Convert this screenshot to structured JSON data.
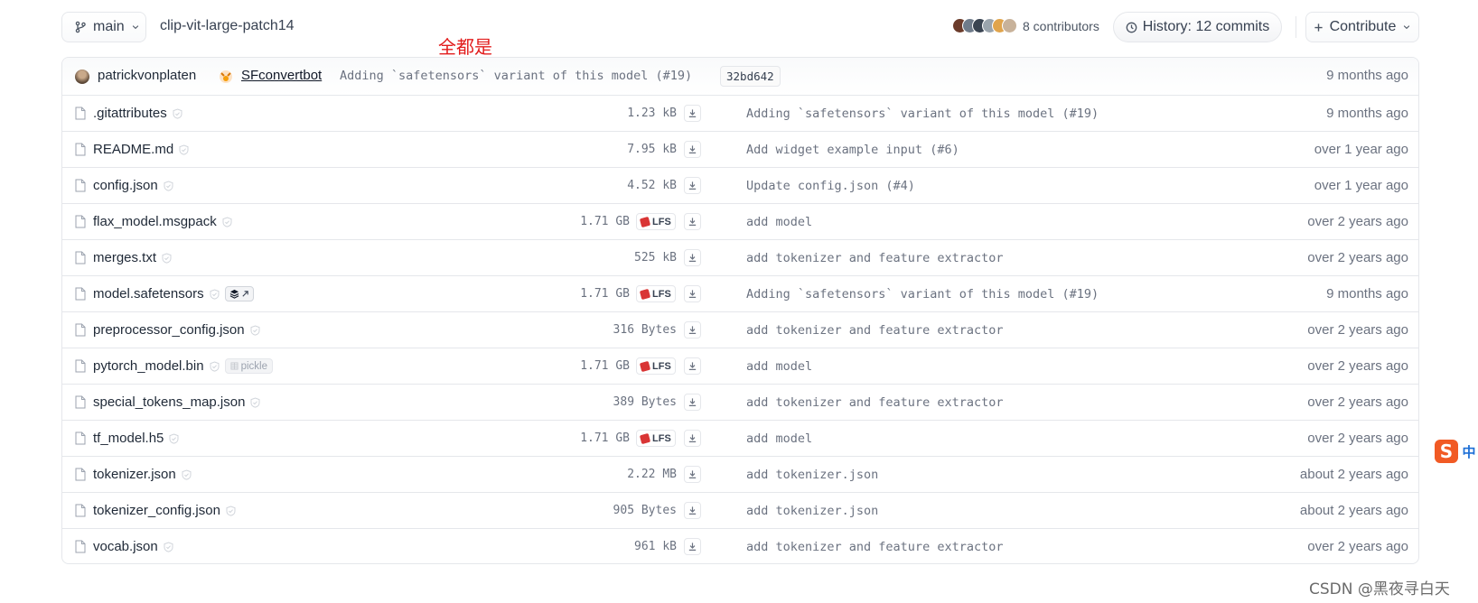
{
  "header": {
    "branch": "main",
    "repo_path": "clip-vit-large-patch14",
    "contributors_label": "8 contributors",
    "history_label": "History: 12 commits",
    "contribute_label": "Contribute"
  },
  "annotation": "全都是",
  "last_commit": {
    "author": "patrickvonplaten",
    "coauthor": "SFconvertbot",
    "message": "Adding `safetensors` variant of this model (#19)",
    "sha": "32bd642",
    "time": "9 months ago"
  },
  "files": [
    {
      "name": ".gitattributes",
      "size": "1.23 kB",
      "lfs": false,
      "message": "Adding `safetensors` variant of this model (#19)",
      "time": "9 months ago"
    },
    {
      "name": "README.md",
      "size": "7.95 kB",
      "lfs": false,
      "message": "Add widget example input (#6)",
      "time": "over 1 year ago"
    },
    {
      "name": "config.json",
      "size": "4.52 kB",
      "lfs": false,
      "message": "Update config.json (#4)",
      "time": "over 1 year ago"
    },
    {
      "name": "flax_model.msgpack",
      "size": "1.71 GB",
      "lfs": true,
      "message": "add model",
      "time": "over 2 years ago"
    },
    {
      "name": "merges.txt",
      "size": "525 kB",
      "lfs": false,
      "message": "add tokenizer and feature extractor",
      "time": "over 2 years ago"
    },
    {
      "name": "model.safetensors",
      "size": "1.71 GB",
      "lfs": true,
      "message": "Adding `safetensors` variant of this model (#19)",
      "time": "9 months ago"
    },
    {
      "name": "preprocessor_config.json",
      "size": "316 Bytes",
      "lfs": false,
      "message": "add tokenizer and feature extractor",
      "time": "over 2 years ago"
    },
    {
      "name": "pytorch_model.bin",
      "size": "1.71 GB",
      "lfs": true,
      "tag": "pickle",
      "message": "add model",
      "time": "over 2 years ago"
    },
    {
      "name": "special_tokens_map.json",
      "size": "389 Bytes",
      "lfs": false,
      "message": "add tokenizer and feature extractor",
      "time": "over 2 years ago"
    },
    {
      "name": "tf_model.h5",
      "size": "1.71 GB",
      "lfs": true,
      "message": "add model",
      "time": "over 2 years ago"
    },
    {
      "name": "tokenizer.json",
      "size": "2.22 MB",
      "lfs": false,
      "message": "add tokenizer.json",
      "time": "about 2 years ago"
    },
    {
      "name": "tokenizer_config.json",
      "size": "905 Bytes",
      "lfs": false,
      "message": "add tokenizer.json",
      "time": "about 2 years ago"
    },
    {
      "name": "vocab.json",
      "size": "961 kB",
      "lfs": false,
      "message": "add tokenizer and feature extractor",
      "time": "over 2 years ago"
    }
  ],
  "lfs_label": "LFS",
  "watermark": "CSDN @黑夜寻白天",
  "ime_label": "中",
  "colors": {
    "lfs_red": "#d93535",
    "annotation_red": "#e21c1c"
  }
}
